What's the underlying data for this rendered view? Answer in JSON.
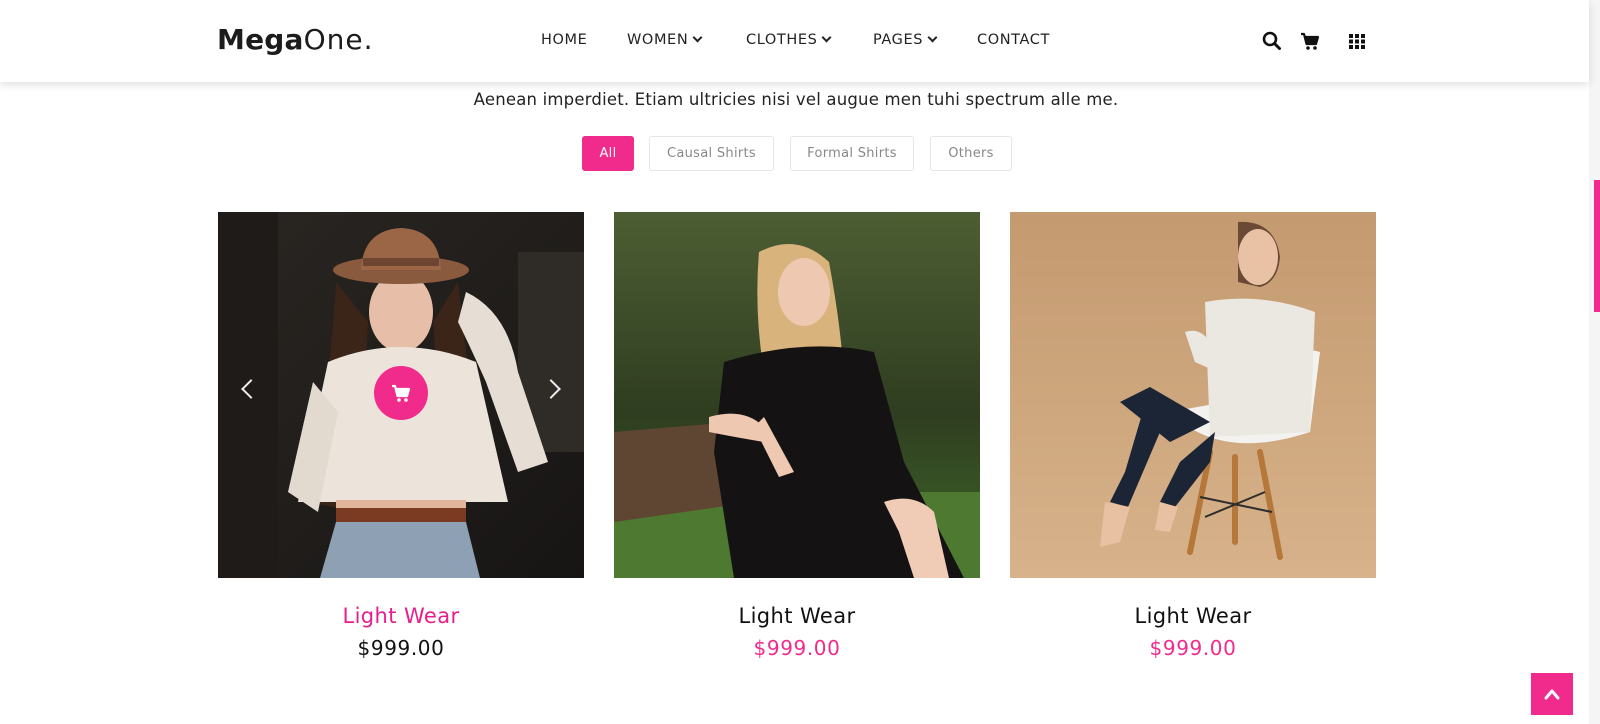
{
  "brand": {
    "bold": "Mega",
    "light": "One."
  },
  "nav": {
    "items": [
      {
        "label": "HOME",
        "dropdown": false
      },
      {
        "label": "WOMEN",
        "dropdown": true
      },
      {
        "label": "CLOTHES",
        "dropdown": true
      },
      {
        "label": "PAGES",
        "dropdown": true
      },
      {
        "label": "CONTACT",
        "dropdown": false
      }
    ]
  },
  "header_icons": [
    "search-icon",
    "cart-icon",
    "grid-menu-icon"
  ],
  "section": {
    "subtitle": "Aenean imperdiet. Etiam ultricies nisi vel augue men tuhi spectrum alle me."
  },
  "filters": {
    "items": [
      {
        "label": "All",
        "active": true
      },
      {
        "label": "Causal Shirts",
        "active": false
      },
      {
        "label": "Formal Shirts",
        "active": false
      },
      {
        "label": "Others",
        "active": false
      }
    ]
  },
  "products": [
    {
      "name": "Light Wear",
      "price": "$999.00"
    },
    {
      "name": "Light Wear",
      "price": "$999.00"
    },
    {
      "name": "Light Wear",
      "price": "$999.00"
    }
  ],
  "colors": {
    "accent": "#f02b8c",
    "text": "#111111",
    "muted": "#888888"
  }
}
